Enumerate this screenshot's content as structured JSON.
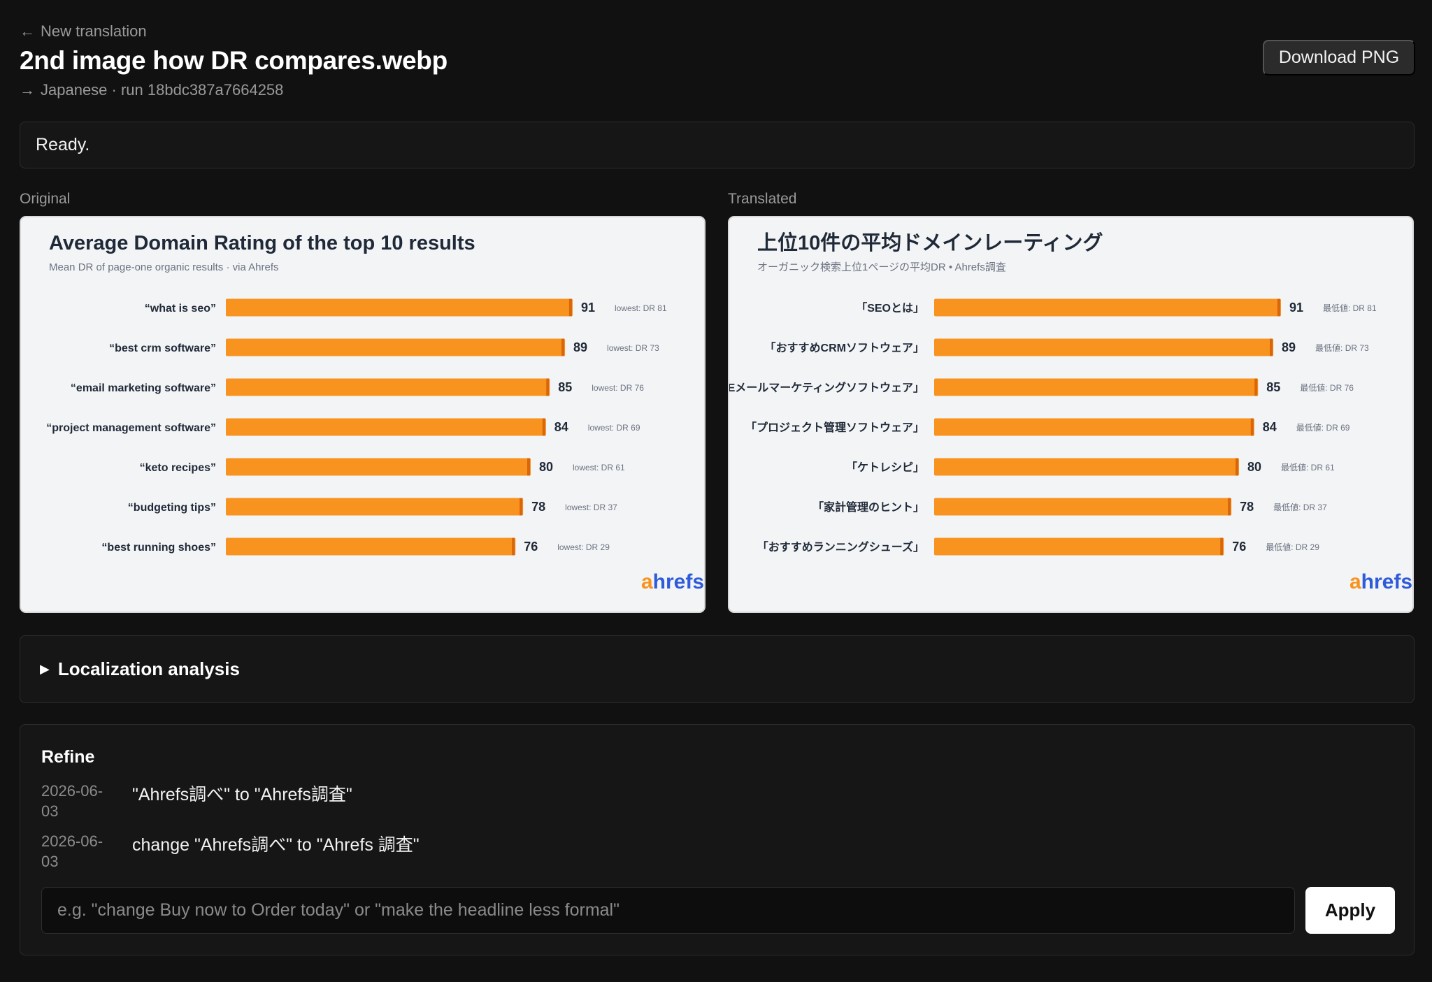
{
  "header": {
    "back_label": "New translation",
    "title": "2nd image how DR compares.webp",
    "subline": "Japanese · run 18bdc387a7664258",
    "download_label": "Download PNG"
  },
  "status": {
    "text": "Ready."
  },
  "panels": {
    "original_label": "Original",
    "translated_label": "Translated"
  },
  "chart_data": [
    {
      "type": "bar",
      "orientation": "horizontal",
      "title": "Average Domain Rating of the top 10 results",
      "subtitle": "Mean DR of page-one organic results · via Ahrefs",
      "categories": [
        "“what is seo”",
        "“best crm software”",
        "“email marketing software”",
        "“project management software”",
        "“keto recipes”",
        "“budgeting tips”",
        "“best running shoes”"
      ],
      "values": [
        91,
        89,
        85,
        84,
        80,
        78,
        76
      ],
      "annotations": [
        "lowest: DR 81",
        "lowest: DR 73",
        "lowest: DR 76",
        "lowest: DR 69",
        "lowest: DR 61",
        "lowest: DR 37",
        "lowest: DR 29"
      ],
      "xlim": [
        0,
        100
      ],
      "grid": false,
      "bar_color": "#f7931e",
      "logo": "ahrefs"
    },
    {
      "type": "bar",
      "orientation": "horizontal",
      "title": "上位10件の平均ドメインレーティング",
      "subtitle": "オーガニック検索上位1ページの平均DR • Ahrefs調査",
      "categories": [
        "「SEOとは」",
        "「おすすめCRMソフトウェア」",
        "「Eメールマーケティングソフトウェア」",
        "「プロジェクト管理ソフトウェア」",
        "「ケトレシピ」",
        "「家計管理のヒント」",
        "「おすすめランニングシューズ」"
      ],
      "values": [
        91,
        89,
        85,
        84,
        80,
        78,
        76
      ],
      "annotations": [
        "最低値: DR 81",
        "最低値: DR 73",
        "最低値: DR 76",
        "最低値: DR 69",
        "最低値: DR 61",
        "最低値: DR 37",
        "最低値: DR 29"
      ],
      "xlim": [
        0,
        100
      ],
      "grid": false,
      "bar_color": "#f7931e",
      "logo": "ahrefs"
    }
  ],
  "analysis": {
    "summary_label": "Localization analysis"
  },
  "refine": {
    "title": "Refine",
    "history": [
      {
        "date": "2026-06-03",
        "text": "\"Ahrefs調べ\" to \"Ahrefs調査\""
      },
      {
        "date": "2026-06-03",
        "text": "change \"Ahrefs調べ\" to \"Ahrefs 調査\""
      }
    ],
    "input_placeholder": "e.g. \"change Buy now to Order today\" or \"make the headline less formal\"",
    "input_value": "",
    "apply_label": "Apply"
  }
}
